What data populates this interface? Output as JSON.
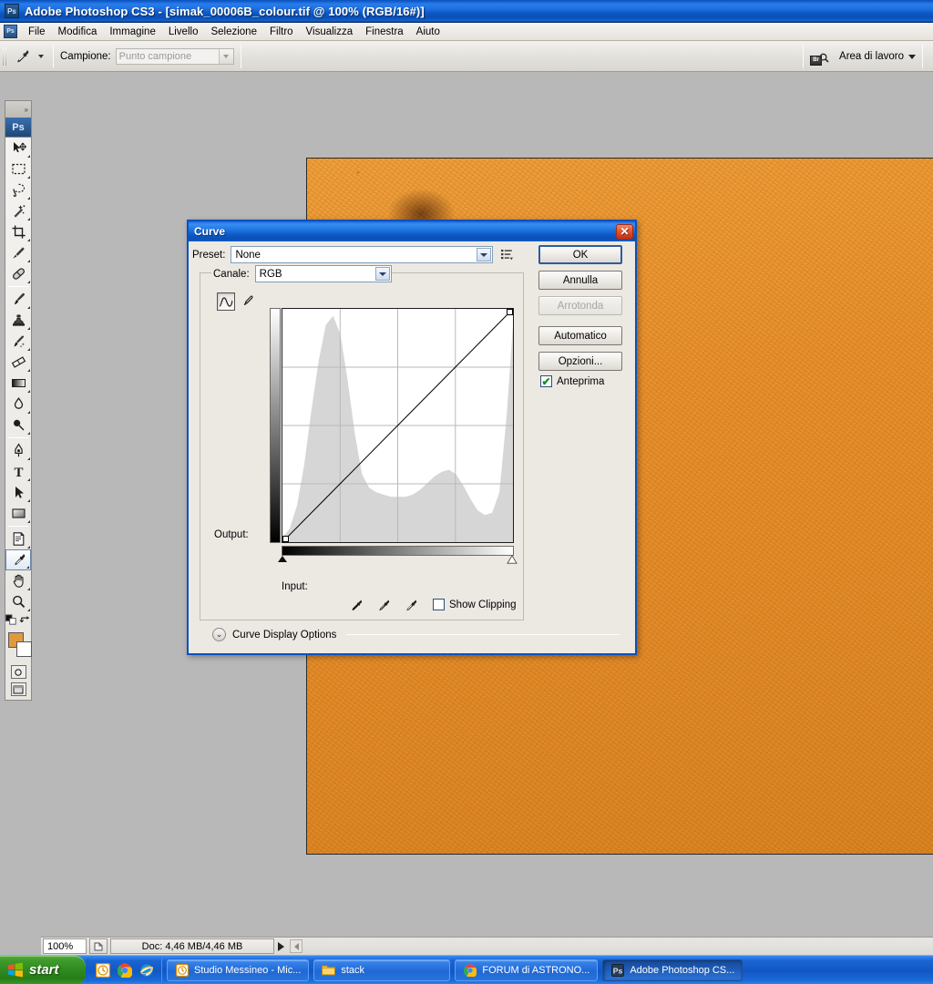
{
  "window": {
    "title": "Adobe Photoshop CS3 - [simak_00006B_colour.tif @ 100% (RGB/16#)]",
    "app_badge": "Ps"
  },
  "menubar": {
    "app_icon": "ps-icon",
    "items": [
      "File",
      "Modifica",
      "Immagine",
      "Livello",
      "Selezione",
      "Filtro",
      "Visualizza",
      "Finestra",
      "Aiuto"
    ]
  },
  "options_bar": {
    "tool_icon": "eyedropper-icon",
    "sample_label": "Campione:",
    "sample_value": "Punto campione",
    "bridge_icon": "bridge-br-icon",
    "workspace_label": "Area di lavoro"
  },
  "toolbox": {
    "badge": "Ps",
    "tools": [
      {
        "name": "move-tool",
        "icon": "move-arrow-icon"
      },
      {
        "name": "rectangular-marquee-tool",
        "icon": "marquee-icon"
      },
      {
        "name": "lasso-tool",
        "icon": "lasso-icon"
      },
      {
        "name": "magic-wand-tool",
        "icon": "magic-wand-icon"
      },
      {
        "name": "crop-tool",
        "icon": "crop-icon"
      },
      {
        "name": "slice-tool",
        "icon": "slice-knife-icon"
      },
      {
        "name": "healing-brush-tool",
        "icon": "healing-bandage-icon"
      },
      {
        "name": "brush-tool",
        "icon": "paintbrush-icon"
      },
      {
        "name": "clone-stamp-tool",
        "icon": "stamp-icon"
      },
      {
        "name": "history-brush-tool",
        "icon": "history-brush-icon"
      },
      {
        "name": "eraser-tool",
        "icon": "eraser-icon"
      },
      {
        "name": "gradient-tool",
        "icon": "gradient-icon"
      },
      {
        "name": "blur-tool",
        "icon": "water-drop-icon"
      },
      {
        "name": "dodge-tool",
        "icon": "dodge-lollipop-icon"
      },
      {
        "name": "pen-tool",
        "icon": "pen-nib-icon"
      },
      {
        "name": "type-tool",
        "icon": "type-T-icon"
      },
      {
        "name": "path-selection-tool",
        "icon": "path-arrow-icon"
      },
      {
        "name": "shape-tool",
        "icon": "rectangle-shape-icon"
      },
      {
        "name": "notes-tool",
        "icon": "note-page-icon"
      },
      {
        "name": "eyedropper-tool",
        "icon": "eyedropper-icon",
        "selected": true
      },
      {
        "name": "hand-tool",
        "icon": "hand-icon"
      },
      {
        "name": "zoom-tool",
        "icon": "magnifier-icon"
      }
    ],
    "foreground_color": "#e09a3c",
    "background_color": "#ffffff",
    "quickmask_icon": "quick-mask-icon",
    "screenmode_icon": "screen-mode-icon"
  },
  "dialog": {
    "title": "Curve",
    "close_icon": "close-x-icon",
    "preset_label": "Preset:",
    "preset_value": "None",
    "preset_menu_icon": "flyout-menu-icon",
    "channel_label": "Canale:",
    "channel_value": "RGB",
    "curve_tool_icon": "curve-edit-icon",
    "pencil_tool_icon": "pencil-draw-icon",
    "output_label": "Output:",
    "input_label": "Input:",
    "show_clipping_label": "Show Clipping",
    "show_clipping_checked": false,
    "curve_display_options_label": "Curve Display Options",
    "curve_display_expand_icon": "chevron-double-down-icon",
    "eyedroppers": [
      {
        "name": "black-point-eyedropper",
        "icon": "eyedropper-black-icon"
      },
      {
        "name": "gray-point-eyedropper",
        "icon": "eyedropper-gray-icon"
      },
      {
        "name": "white-point-eyedropper",
        "icon": "eyedropper-white-icon"
      }
    ],
    "buttons": [
      {
        "name": "ok-button",
        "label": "OK",
        "default": true,
        "disabled": false
      },
      {
        "name": "cancel-button",
        "label": "Annulla",
        "default": false,
        "disabled": false
      },
      {
        "name": "smooth-button",
        "label": "Arrotonda",
        "default": false,
        "disabled": true
      },
      {
        "name": "auto-button",
        "label": "Automatico",
        "default": false,
        "disabled": false
      },
      {
        "name": "options-button",
        "label": "Opzioni...",
        "default": false,
        "disabled": false
      }
    ],
    "preview_label": "Anteprima",
    "preview_checked": true
  },
  "chart_data": {
    "type": "area",
    "title": "Curves histogram (RGB composite)",
    "xlabel": "Input",
    "ylabel": "Output",
    "xlim": [
      0,
      255
    ],
    "ylim": [
      0,
      1
    ],
    "grid": true,
    "grid_divisions": 4,
    "curve_points": [
      [
        0,
        0
      ],
      [
        255,
        255
      ]
    ],
    "curve_line_color": "#000000",
    "histogram_x": [
      0,
      8,
      16,
      24,
      32,
      40,
      48,
      56,
      64,
      72,
      80,
      88,
      96,
      104,
      112,
      120,
      128,
      136,
      144,
      152,
      160,
      168,
      176,
      184,
      192,
      200,
      208,
      216,
      224,
      232,
      240,
      248,
      255
    ],
    "histogram_values": [
      0.02,
      0.06,
      0.16,
      0.34,
      0.58,
      0.8,
      0.96,
      1.0,
      0.92,
      0.72,
      0.48,
      0.3,
      0.24,
      0.22,
      0.21,
      0.2,
      0.2,
      0.2,
      0.21,
      0.23,
      0.26,
      0.29,
      0.31,
      0.32,
      0.3,
      0.25,
      0.19,
      0.14,
      0.12,
      0.13,
      0.22,
      0.56,
      0.96
    ],
    "histogram_fill_color": "#d6d6d6",
    "gradient_ramp_horizontal": [
      "#000000",
      "#ffffff"
    ],
    "gradient_ramp_vertical": [
      "#000000",
      "#ffffff"
    ],
    "black_marker_position": 0,
    "white_marker_position": 255
  },
  "status_bar": {
    "zoom": "100%",
    "doc_icon": "doc-size-icon",
    "doc_info": "Doc: 4,46 MB/4,46 MB",
    "play_icon": "play-arrow-icon",
    "left_icon": "left-arrow-icon"
  },
  "taskbar": {
    "start_label": "start",
    "start_icon": "windows-flag-icon",
    "quick_launch": [
      {
        "name": "ql-clock-icon",
        "icon": "clock-icon"
      },
      {
        "name": "ql-chrome-icon",
        "icon": "chrome-icon"
      },
      {
        "name": "ql-ie-icon",
        "icon": "internet-explorer-icon"
      }
    ],
    "tasks": [
      {
        "name": "task-studio-messineo",
        "label": "Studio Messineo - Mic...",
        "icon": "clock-icon",
        "active": false
      },
      {
        "name": "task-stack",
        "label": "stack",
        "icon": "folder-icon",
        "active": false
      },
      {
        "name": "task-forum-astronomia",
        "label": "FORUM di ASTRONO...",
        "icon": "chrome-icon",
        "active": false
      },
      {
        "name": "task-photoshop",
        "label": "Adobe Photoshop CS...",
        "icon": "ps-icon",
        "active": true
      }
    ]
  }
}
